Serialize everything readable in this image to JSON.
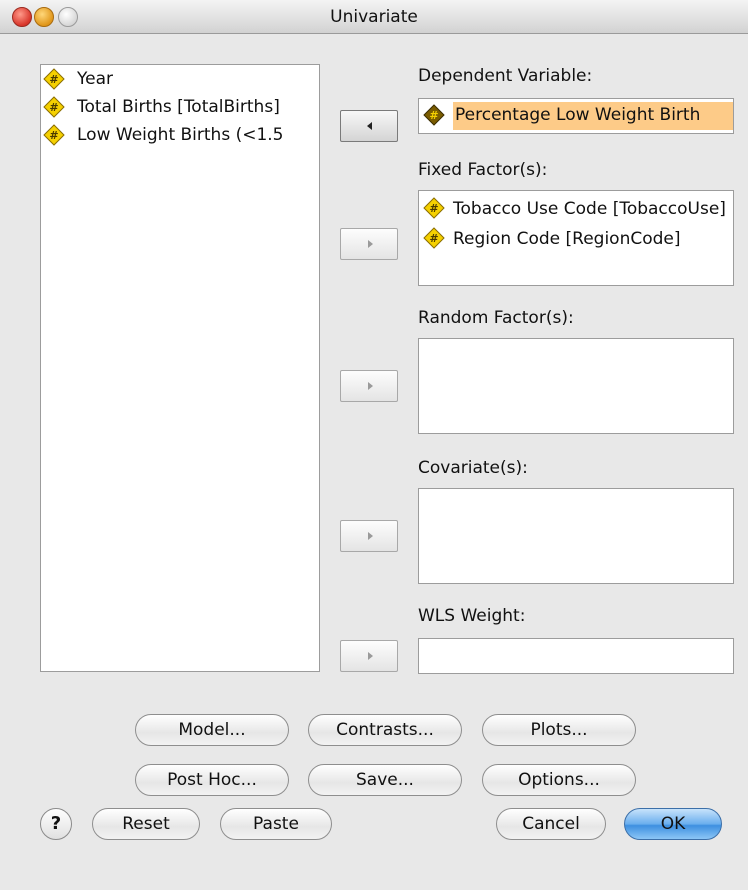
{
  "window": {
    "title": "Univariate"
  },
  "variables": [
    {
      "label": "Year",
      "icon": "scale-variable-icon"
    },
    {
      "label": "Total Births [TotalBirths]",
      "icon": "scale-variable-icon"
    },
    {
      "label": "Low Weight Births (<1.5",
      "icon": "scale-variable-icon"
    }
  ],
  "dependent": {
    "label": "Dependent Variable:",
    "value": "Percentage Low Weight Birth"
  },
  "fixed": {
    "label": "Fixed Factor(s):",
    "items": [
      "Tobacco Use Code [TobaccoUse]",
      "Region Code [RegionCode]"
    ]
  },
  "random": {
    "label": "Random Factor(s):"
  },
  "covariates": {
    "label": "Covariate(s):"
  },
  "wls": {
    "label": "WLS Weight:"
  },
  "buttons": {
    "model": "Model...",
    "contrasts": "Contrasts...",
    "plots": "Plots...",
    "post_hoc": "Post Hoc...",
    "save": "Save...",
    "options": "Options...",
    "help": "?",
    "reset": "Reset",
    "paste": "Paste",
    "cancel": "Cancel",
    "ok": "OK"
  },
  "colors": {
    "selection": "#fdcb88",
    "icon_fill": "#f5d000",
    "ok_button": "#5aa3ea"
  }
}
